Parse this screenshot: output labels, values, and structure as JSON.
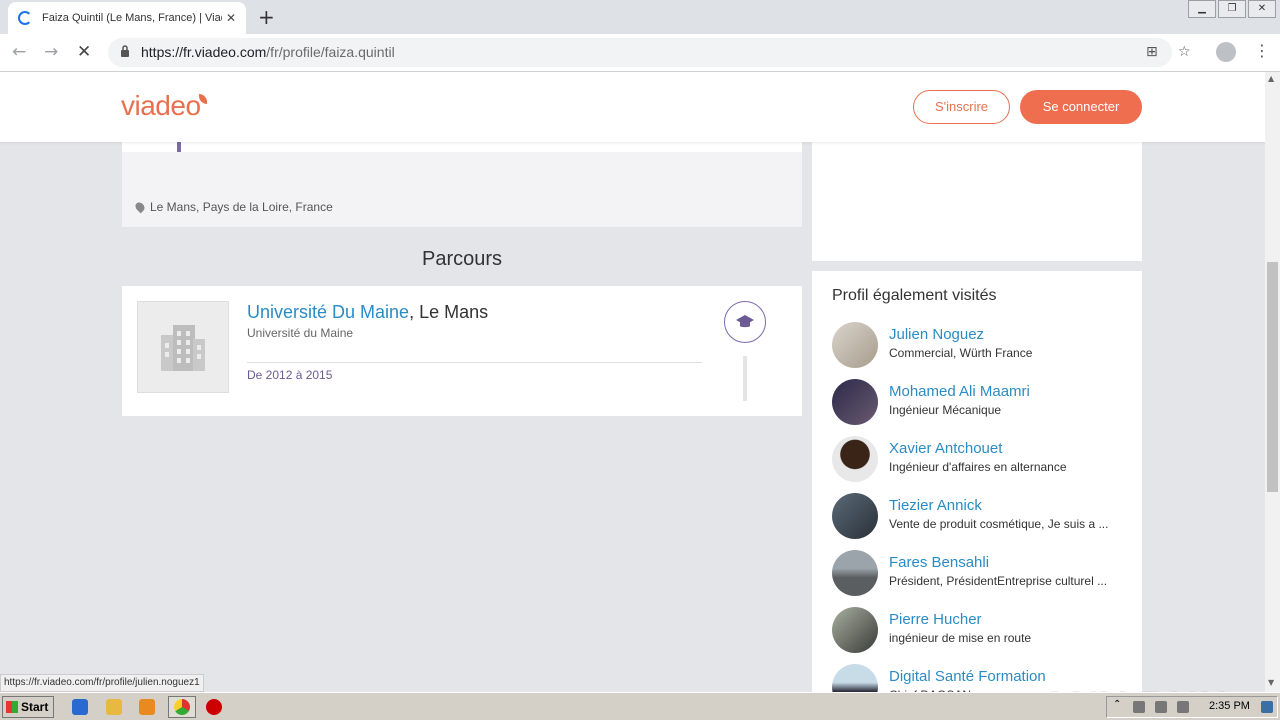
{
  "browser": {
    "tab_title": "Faiza Quintil (Le Mans, France) | Viadeo",
    "url_host": "https://fr.viadeo.com",
    "url_path": "/fr/profile/faiza.quintil",
    "status_url": "https://fr.viadeo.com/fr/profile/julien.noguez1"
  },
  "header": {
    "logo": "viadeo",
    "register_label": "S'inscrire",
    "login_label": "Se connecter",
    "accent_color": "#ef6e50"
  },
  "profile": {
    "location": "Le Mans, Pays de la Loire, France"
  },
  "parcours": {
    "title": "Parcours",
    "school_link": "Université Du Maine",
    "school_city": ", Le Mans",
    "school_sub": "Université du Maine",
    "dates": "De 2012 à 2015"
  },
  "sidebar": {
    "title": "Profil également visités",
    "people": [
      {
        "name": "Julien Noguez",
        "role": "Commercial, Würth France"
      },
      {
        "name": "Mohamed Ali Maamri",
        "role": "Ingénieur Mécanique"
      },
      {
        "name": "Xavier Antchouet",
        "role": "Ingénieur d'affaires en alternance"
      },
      {
        "name": "Tiezier Annick",
        "role": "Vente de produit cosmétique, Je suis a ..."
      },
      {
        "name": "Fares Bensahli",
        "role": "Président, PrésidentEntreprise culturel ..."
      },
      {
        "name": "Pierre Hucher",
        "role": "ingénieur de mise en route"
      },
      {
        "name": "Digital Santé Formation",
        "role": "Chief DAOSAN"
      }
    ]
  },
  "watermark": "ANY RUN",
  "taskbar": {
    "start_label": "Start",
    "clock": "2:35 PM"
  }
}
